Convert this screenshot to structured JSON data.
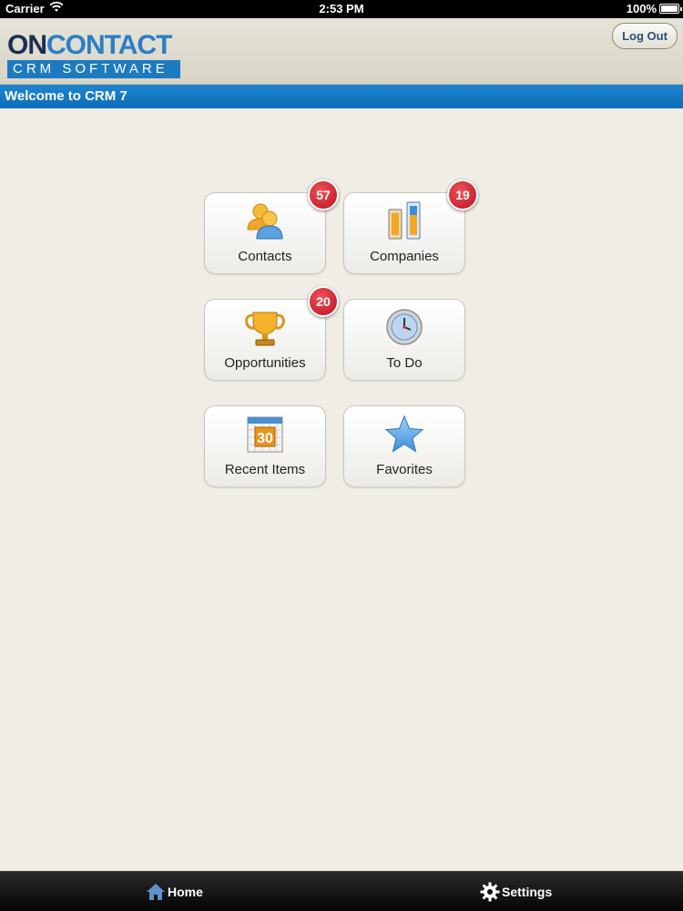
{
  "status_bar": {
    "carrier": "Carrier",
    "time": "2:53 PM",
    "battery": "100%"
  },
  "header": {
    "logo_on": "ON",
    "logo_contact": "CONTACT",
    "logo_tagline": "CRM SOFTWARE",
    "logout_label": "Log Out"
  },
  "welcome": {
    "text": "Welcome to CRM 7"
  },
  "tiles": [
    {
      "label": "Contacts",
      "icon": "contacts-icon",
      "badge": "57"
    },
    {
      "label": "Companies",
      "icon": "companies-icon",
      "badge": "19"
    },
    {
      "label": "Opportunities",
      "icon": "trophy-icon",
      "badge": "20"
    },
    {
      "label": "To Do",
      "icon": "clock-icon",
      "badge": ""
    },
    {
      "label": "Recent Items",
      "icon": "calendar-icon",
      "badge": "",
      "calendar_day": "30"
    },
    {
      "label": "Favorites",
      "icon": "star-icon",
      "badge": ""
    }
  ],
  "tab_bar": {
    "home_label": "Home",
    "settings_label": "Settings"
  },
  "colors": {
    "accent_blue": "#1d7ac0",
    "badge_red": "#c8202a",
    "background": "#efede6"
  }
}
